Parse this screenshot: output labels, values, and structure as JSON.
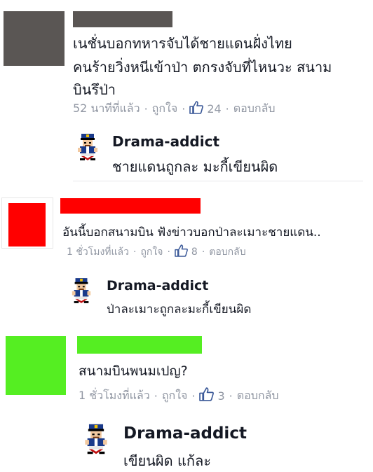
{
  "comments": [
    {
      "text_lines": [
        "เนชั่นบอกทหารจับได้ชายแดนฝั่งไทย",
        "คนร้ายวิ่งหนีเข้าป่า ตกรงจับที่ไหนวะ สนาม",
        "บินรึป่า"
      ],
      "time": "52 นาทีที่แล้ว",
      "like_label": "ถูกใจ",
      "like_count": "24",
      "reply_label": "ตอบกลับ",
      "avatar_color": "#5a5654",
      "name_bar_color": "#5a5654",
      "reply": {
        "author": "Drama-addict",
        "text": "ชายแดนถูกละ มะกี้เขียนผิด"
      }
    },
    {
      "text_lines": [
        "อันนี้บอกสนามบิน ฟังข่าวบอกป่าละเมาะชายแดน.."
      ],
      "time": "1 ชั่วโมงที่แล้ว",
      "like_label": "ถูกใจ",
      "like_count": "8",
      "reply_label": "ตอบกลับ",
      "avatar_color": "#ff0000",
      "name_bar_color": "#ff0000",
      "reply": {
        "author": "Drama-addict",
        "text": "ป่าละเมาะถูกละมะกี้เขียนผิด"
      }
    },
    {
      "text_lines": [
        "สนามบินพนมเปญ?"
      ],
      "time": "1 ชั่วโมงที่แล้ว",
      "like_label": "ถูกใจ",
      "like_count": "3",
      "reply_label": "ตอบกลับ",
      "avatar_color": "#55ee22",
      "name_bar_color": "#55ee22",
      "reply": {
        "author": "Drama-addict",
        "text": "เขียนผิด แก้ละ"
      }
    }
  ],
  "colors": {
    "text": "#141823",
    "meta": "#9197a3",
    "link_blue": "#3b5998"
  },
  "icons": {
    "like": "thumbs-up-icon",
    "mascot": "drama-addict-mascot-icon"
  }
}
